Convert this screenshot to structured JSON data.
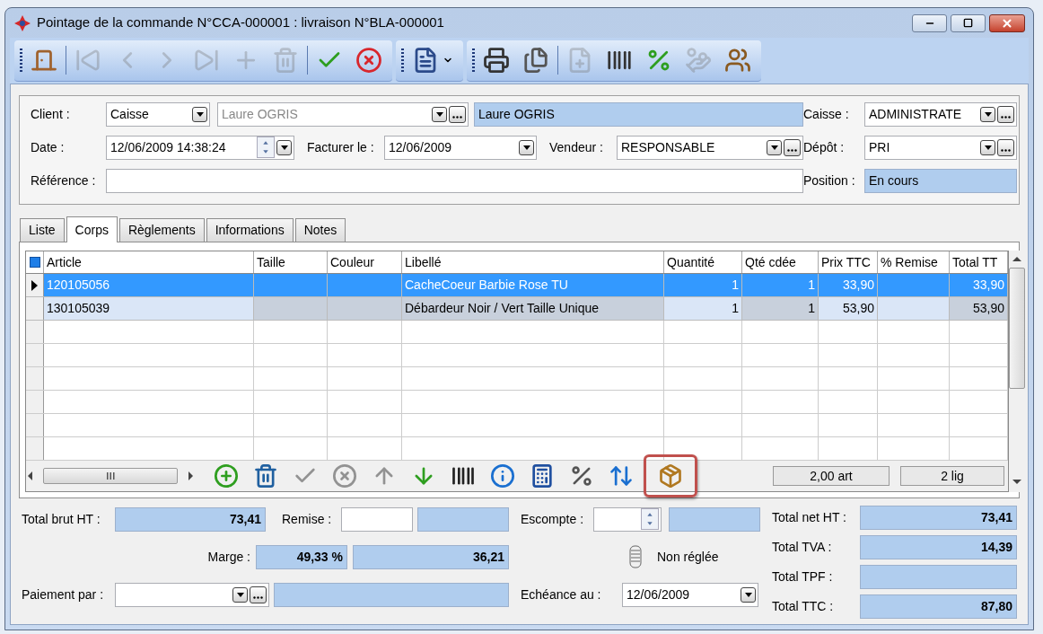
{
  "window": {
    "title": "Pointage de la commande N°CCA-000001 : livraison N°BLA-000001"
  },
  "toolbar_groups": [
    {
      "buttons": [
        {
          "disabled": false
        },
        {
          "disabled": true
        },
        {
          "disabled": true
        },
        {
          "disabled": true
        },
        {
          "disabled": true
        },
        {
          "disabled": true
        },
        {
          "disabled": true
        },
        {
          "disabled": false
        },
        {
          "disabled": false
        }
      ]
    },
    {
      "buttons": [
        {
          "disabled": false
        }
      ]
    },
    {
      "buttons": [
        {
          "disabled": false
        },
        {
          "disabled": false
        },
        {
          "disabled": true
        },
        {
          "disabled": false
        },
        {
          "disabled": false
        },
        {
          "disabled": true
        },
        {
          "disabled": false
        }
      ]
    }
  ],
  "header": {
    "client": {
      "label": "Client :",
      "type_value": "Caisse",
      "name_value": "Laure OGRIS",
      "display": "Laure OGRIS"
    },
    "caisse": {
      "label": "Caisse :",
      "value": "ADMINISTRATE"
    },
    "date": {
      "label": "Date :",
      "value": "12/06/2009 14:38:24"
    },
    "facturer_le": {
      "label": "Facturer le :",
      "value": "12/06/2009"
    },
    "vendeur": {
      "label": "Vendeur :",
      "value": "RESPONSABLE"
    },
    "depot": {
      "label": "Dépôt :",
      "value": "PRI"
    },
    "reference": {
      "label": "Référence :"
    },
    "position": {
      "label": "Position :",
      "value": "En cours"
    }
  },
  "tabs": [
    {
      "label": "Liste",
      "selected": false
    },
    {
      "label": "Corps",
      "selected": true
    },
    {
      "label": "Règlements",
      "selected": false
    },
    {
      "label": "Informations",
      "selected": false
    },
    {
      "label": "Notes",
      "selected": false
    }
  ],
  "table": {
    "select_all_checked": true,
    "columns": [
      {
        "label": "Article",
        "readonly": false
      },
      {
        "label": "Taille",
        "readonly": true
      },
      {
        "label": "Couleur",
        "readonly": true
      },
      {
        "label": "Libellé",
        "readonly": true
      },
      {
        "label": "Quantité",
        "readonly": false
      },
      {
        "label": "Qté cdée",
        "readonly": true
      },
      {
        "label": "Prix TTC",
        "readonly": false
      },
      {
        "label": "% Remise",
        "readonly": false
      },
      {
        "label": "Total TT",
        "readonly": true
      }
    ],
    "rows": [
      {
        "selected": true,
        "cells": [
          "120105056",
          "",
          "",
          "CacheCoeur Barbie Rose TU",
          "1",
          "1",
          "33,90",
          "",
          "33,90"
        ]
      },
      {
        "selected": false,
        "cells": [
          "130105039",
          "",
          "",
          "Débardeur Noir / Vert Taille Unique",
          "1",
          "1",
          "53,90",
          "",
          "53,90"
        ]
      }
    ]
  },
  "grid_toolbar": [
    {
      "disabled": false,
      "highlighted": false
    },
    {
      "disabled": false,
      "highlighted": false
    },
    {
      "disabled": true,
      "highlighted": false
    },
    {
      "disabled": true,
      "highlighted": false
    },
    {
      "disabled": true,
      "highlighted": false
    },
    {
      "disabled": false,
      "highlighted": false
    },
    {
      "disabled": false,
      "highlighted": false
    },
    {
      "disabled": false,
      "highlighted": false
    },
    {
      "disabled": false,
      "highlighted": false
    },
    {
      "disabled": false,
      "highlighted": false
    },
    {
      "disabled": false,
      "highlighted": false
    },
    {
      "disabled": false,
      "highlighted": true
    }
  ],
  "grid_summary": {
    "articles": "2,00 art",
    "lines": "2 lig"
  },
  "totals": {
    "total_brut_ht": {
      "label": "Total brut HT :",
      "value": "73,41"
    },
    "remise": {
      "label": "Remise :"
    },
    "escompte": {
      "label": "Escompte :"
    },
    "marge": {
      "label": "Marge :",
      "percent": "49,33 %",
      "value": "36,21"
    },
    "payment_status": "Non réglée",
    "paiement_par": {
      "label": "Paiement par :"
    },
    "echeance": {
      "label": "Echéance au :",
      "value": "12/06/2009"
    },
    "total_net_ht": {
      "label": "Total net HT :",
      "value": "73,41"
    },
    "total_tva": {
      "label": "Total TVA :",
      "value": "14,39"
    },
    "total_tpf": {
      "label": "Total TPF :"
    },
    "total_ttc": {
      "label": "Total TTC :",
      "value": "87,80"
    }
  }
}
